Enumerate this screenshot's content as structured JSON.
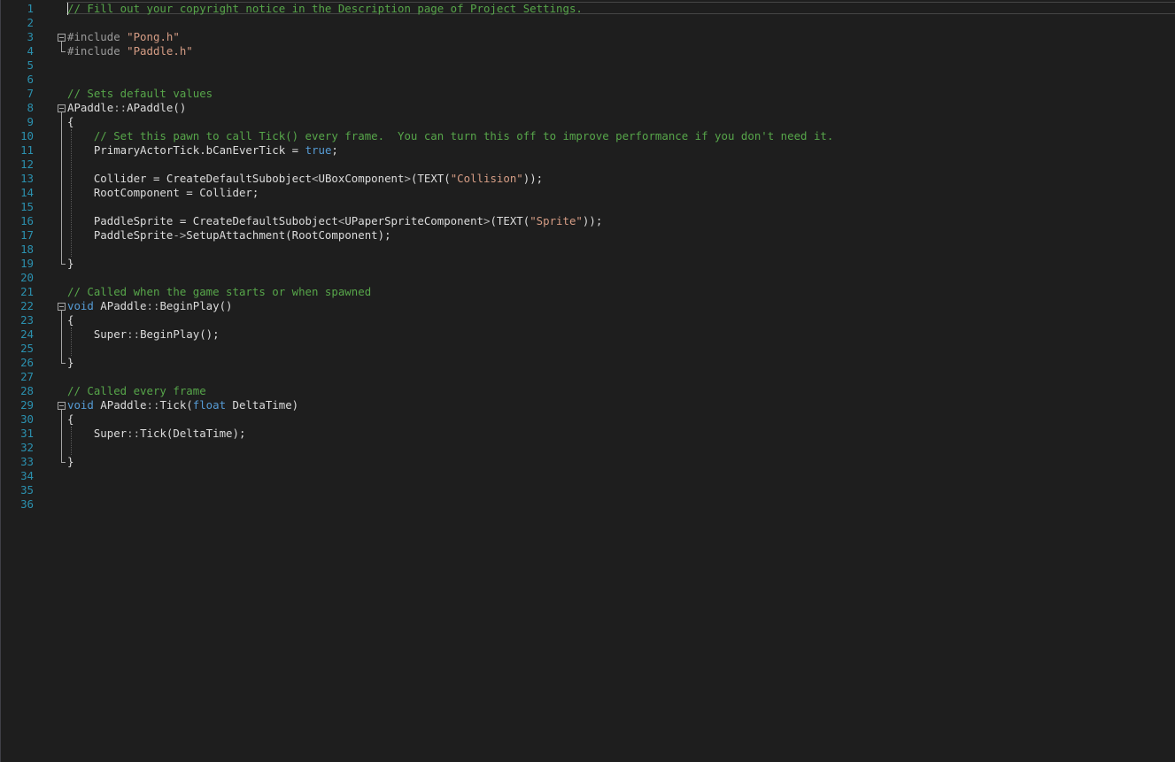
{
  "editor": {
    "language": "C++",
    "colors": {
      "background": "#1e1e1e",
      "line_number": "#2b91af",
      "comment": "#57a64a",
      "preprocessor": "#9b9b9b",
      "string": "#d69d85",
      "keyword": "#569cd6",
      "text": "#dcdcdc"
    },
    "lines": [
      {
        "n": "1",
        "tokens": [
          {
            "t": "// Fill out your copyright notice in the Description page of Project Settings.",
            "c": "comment"
          }
        ]
      },
      {
        "n": "2",
        "tokens": []
      },
      {
        "n": "3",
        "tokens": [
          {
            "t": "#include ",
            "c": "pre"
          },
          {
            "t": "\"Pong.h\"",
            "c": "string"
          }
        ]
      },
      {
        "n": "4",
        "tokens": [
          {
            "t": "#include ",
            "c": "pre"
          },
          {
            "t": "\"Paddle.h\"",
            "c": "string"
          }
        ]
      },
      {
        "n": "5",
        "tokens": []
      },
      {
        "n": "6",
        "tokens": []
      },
      {
        "n": "7",
        "tokens": [
          {
            "t": "// Sets default values",
            "c": "comment"
          }
        ]
      },
      {
        "n": "8",
        "tokens": [
          {
            "t": "APaddle",
            "c": "plain"
          },
          {
            "t": "::",
            "c": "op"
          },
          {
            "t": "APaddle()",
            "c": "plain"
          }
        ]
      },
      {
        "n": "9",
        "tokens": [
          {
            "t": "{",
            "c": "plain"
          }
        ]
      },
      {
        "n": "10",
        "tokens": [
          {
            "t": "    // Set this pawn to call Tick() every frame.  You can turn this off to improve performance if you don't need it.",
            "c": "comment"
          }
        ]
      },
      {
        "n": "11",
        "tokens": [
          {
            "t": "    PrimaryActorTick.bCanEverTick = ",
            "c": "plain"
          },
          {
            "t": "true",
            "c": "kw"
          },
          {
            "t": ";",
            "c": "plain"
          }
        ]
      },
      {
        "n": "12",
        "tokens": []
      },
      {
        "n": "13",
        "tokens": [
          {
            "t": "    Collider = CreateDefaultSubobject",
            "c": "plain"
          },
          {
            "t": "<",
            "c": "op"
          },
          {
            "t": "UBoxComponent",
            "c": "plain"
          },
          {
            "t": ">",
            "c": "op"
          },
          {
            "t": "(TEXT(",
            "c": "plain"
          },
          {
            "t": "\"Collision\"",
            "c": "string"
          },
          {
            "t": "));",
            "c": "plain"
          }
        ]
      },
      {
        "n": "14",
        "tokens": [
          {
            "t": "    RootComponent = Collider;",
            "c": "plain"
          }
        ]
      },
      {
        "n": "15",
        "tokens": []
      },
      {
        "n": "16",
        "tokens": [
          {
            "t": "    PaddleSprite = CreateDefaultSubobject",
            "c": "plain"
          },
          {
            "t": "<",
            "c": "op"
          },
          {
            "t": "UPaperSpriteComponent",
            "c": "plain"
          },
          {
            "t": ">",
            "c": "op"
          },
          {
            "t": "(TEXT(",
            "c": "plain"
          },
          {
            "t": "\"Sprite\"",
            "c": "string"
          },
          {
            "t": "));",
            "c": "plain"
          }
        ]
      },
      {
        "n": "17",
        "tokens": [
          {
            "t": "    PaddleSprite",
            "c": "plain"
          },
          {
            "t": "->",
            "c": "op"
          },
          {
            "t": "SetupAttachment(RootComponent);",
            "c": "plain"
          }
        ]
      },
      {
        "n": "18",
        "tokens": []
      },
      {
        "n": "19",
        "tokens": [
          {
            "t": "}",
            "c": "plain"
          }
        ]
      },
      {
        "n": "20",
        "tokens": []
      },
      {
        "n": "21",
        "tokens": [
          {
            "t": "// Called when the game starts or when spawned",
            "c": "comment"
          }
        ]
      },
      {
        "n": "22",
        "tokens": [
          {
            "t": "void",
            "c": "kw"
          },
          {
            "t": " APaddle",
            "c": "plain"
          },
          {
            "t": "::",
            "c": "op"
          },
          {
            "t": "BeginPlay()",
            "c": "plain"
          }
        ]
      },
      {
        "n": "23",
        "tokens": [
          {
            "t": "{",
            "c": "plain"
          }
        ]
      },
      {
        "n": "24",
        "tokens": [
          {
            "t": "    Super",
            "c": "plain"
          },
          {
            "t": "::",
            "c": "op"
          },
          {
            "t": "BeginPlay();",
            "c": "plain"
          }
        ]
      },
      {
        "n": "25",
        "tokens": []
      },
      {
        "n": "26",
        "tokens": [
          {
            "t": "}",
            "c": "plain"
          }
        ]
      },
      {
        "n": "27",
        "tokens": []
      },
      {
        "n": "28",
        "tokens": [
          {
            "t": "// Called every frame",
            "c": "comment"
          }
        ]
      },
      {
        "n": "29",
        "tokens": [
          {
            "t": "void",
            "c": "kw"
          },
          {
            "t": " APaddle",
            "c": "plain"
          },
          {
            "t": "::",
            "c": "op"
          },
          {
            "t": "Tick(",
            "c": "plain"
          },
          {
            "t": "float",
            "c": "kw"
          },
          {
            "t": " DeltaTime)",
            "c": "plain"
          }
        ]
      },
      {
        "n": "30",
        "tokens": [
          {
            "t": "{",
            "c": "plain"
          }
        ]
      },
      {
        "n": "31",
        "tokens": [
          {
            "t": "    Super",
            "c": "plain"
          },
          {
            "t": "::",
            "c": "op"
          },
          {
            "t": "Tick(DeltaTime);",
            "c": "plain"
          }
        ]
      },
      {
        "n": "32",
        "tokens": []
      },
      {
        "n": "33",
        "tokens": [
          {
            "t": "}",
            "c": "plain"
          }
        ]
      },
      {
        "n": "34",
        "tokens": []
      },
      {
        "n": "35",
        "tokens": []
      },
      {
        "n": "36",
        "tokens": []
      }
    ],
    "fold_markers": [
      "3",
      "8",
      "22",
      "29"
    ]
  }
}
